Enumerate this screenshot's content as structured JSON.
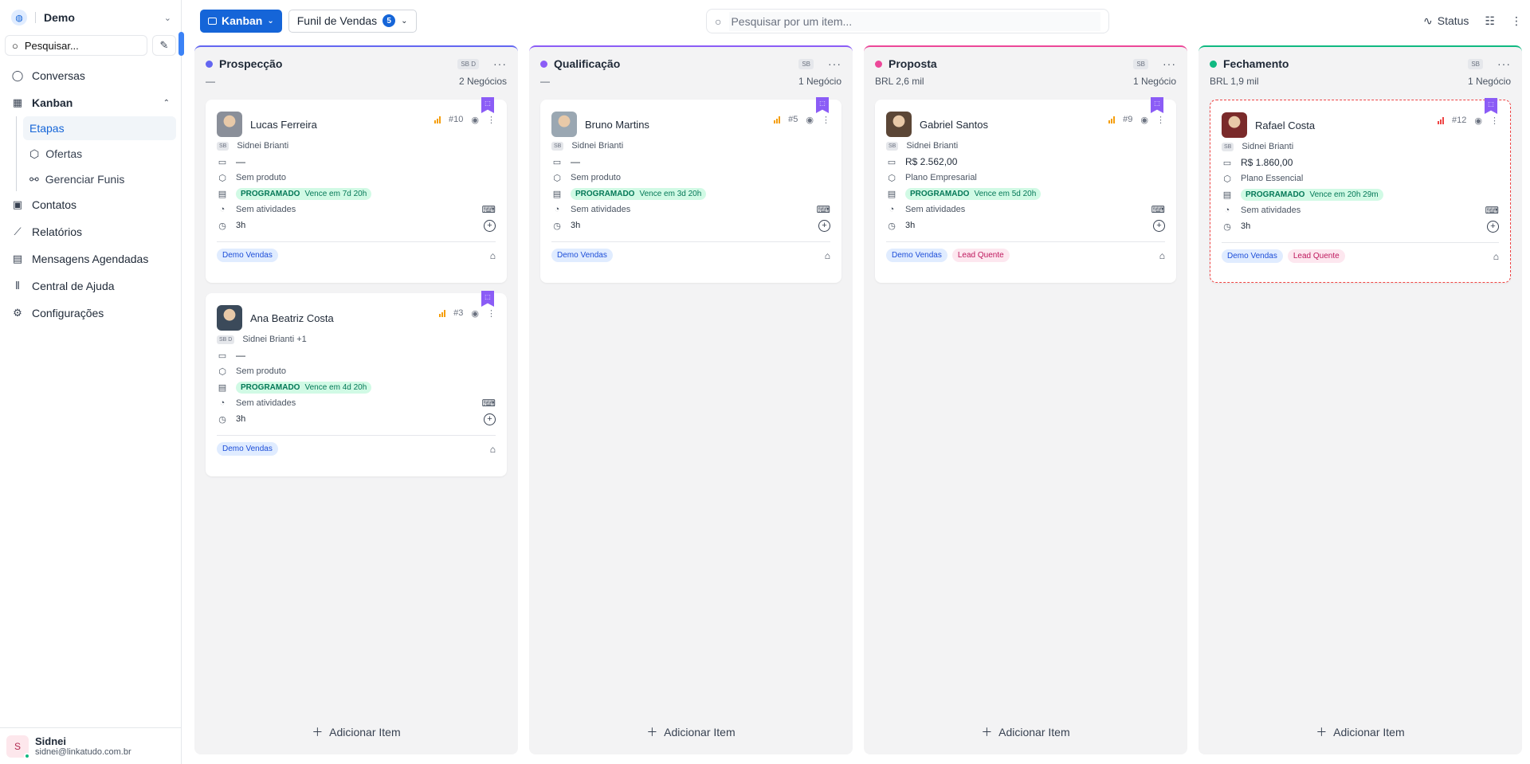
{
  "workspace": {
    "name": "Demo"
  },
  "sidebar": {
    "search": "Pesquisar...",
    "items": [
      {
        "label": "Conversas",
        "icon": "chat-icon"
      },
      {
        "label": "Kanban",
        "icon": "grid-icon"
      },
      {
        "label": "Contatos",
        "icon": "contacts-icon"
      },
      {
        "label": "Relatórios",
        "icon": "chart-icon"
      },
      {
        "label": "Mensagens Agendadas",
        "icon": "calendar-clock-icon"
      },
      {
        "label": "Central de Ajuda",
        "icon": "library-icon"
      },
      {
        "label": "Configurações",
        "icon": "gear-icon"
      }
    ],
    "kanban_sub": [
      {
        "label": "Etapas",
        "active": true
      },
      {
        "label": "Ofertas",
        "icon": "box-icon"
      },
      {
        "label": "Gerenciar Funis",
        "icon": "workflow-icon"
      }
    ]
  },
  "user": {
    "initial": "S",
    "name": "Sidnei",
    "email": "sidnei@linkatudo.com.br"
  },
  "toolbar": {
    "view_label": "Kanban",
    "funnel_label": "Funil de Vendas",
    "funnel_count": "5",
    "search_placeholder": "Pesquisar por um item...",
    "status_label": "Status"
  },
  "columns": [
    {
      "title": "Prospecção",
      "color": "#6366f1",
      "owner_tag": "SB D",
      "value": "—",
      "count": "2 Negócios",
      "cards": [
        {
          "name": "Lucas Ferreira",
          "id": "#10",
          "owner": "Sidnei Brianti",
          "owner_tag": "SB",
          "value": "—",
          "product": "Sem produto",
          "status": "PROGRAMADO",
          "due": "Vence em 7d 20h",
          "activities": "Sem atividades",
          "time": "3h",
          "tags": [
            "Demo Vendas"
          ]
        },
        {
          "name": "Ana Beatriz Costa",
          "id": "#3",
          "owner": "Sidnei Brianti +1",
          "owner_tag": "SB D",
          "value": "—",
          "product": "Sem produto",
          "status": "PROGRAMADO",
          "due": "Vence em 4d 20h",
          "activities": "Sem atividades",
          "time": "3h",
          "tags": [
            "Demo Vendas"
          ]
        }
      ]
    },
    {
      "title": "Qualificação",
      "color": "#8b5cf6",
      "owner_tag": "SB",
      "value": "—",
      "count": "1 Negócio",
      "cards": [
        {
          "name": "Bruno Martins",
          "id": "#5",
          "owner": "Sidnei Brianti",
          "owner_tag": "SB",
          "value": "—",
          "product": "Sem produto",
          "status": "PROGRAMADO",
          "due": "Vence em 3d 20h",
          "activities": "Sem atividades",
          "time": "3h",
          "tags": [
            "Demo Vendas"
          ]
        }
      ]
    },
    {
      "title": "Proposta",
      "color": "#ec4899",
      "owner_tag": "SB",
      "value": "BRL 2,6 mil",
      "count": "1 Negócio",
      "cards": [
        {
          "name": "Gabriel Santos",
          "id": "#9",
          "owner": "Sidnei Brianti",
          "owner_tag": "SB",
          "value": "R$ 2.562,00",
          "product": "Plano Empresarial",
          "status": "PROGRAMADO",
          "due": "Vence em 5d 20h",
          "activities": "Sem atividades",
          "time": "3h",
          "tags": [
            "Demo Vendas",
            "Lead Quente"
          ]
        }
      ]
    },
    {
      "title": "Fechamento",
      "color": "#10b981",
      "owner_tag": "SB",
      "value": "BRL 1,9 mil",
      "count": "1 Negócio",
      "cards": [
        {
          "name": "Rafael Costa",
          "id": "#12",
          "owner": "Sidnei Brianti",
          "owner_tag": "SB",
          "value": "R$ 1.860,00",
          "product": "Plano Essencial",
          "status": "PROGRAMADO",
          "due": "Vence em 20h 29m",
          "activities": "Sem atividades",
          "time": "3h",
          "tags": [
            "Demo Vendas",
            "Lead Quente"
          ]
        }
      ]
    }
  ],
  "add_item_label": "Adicionar Item"
}
